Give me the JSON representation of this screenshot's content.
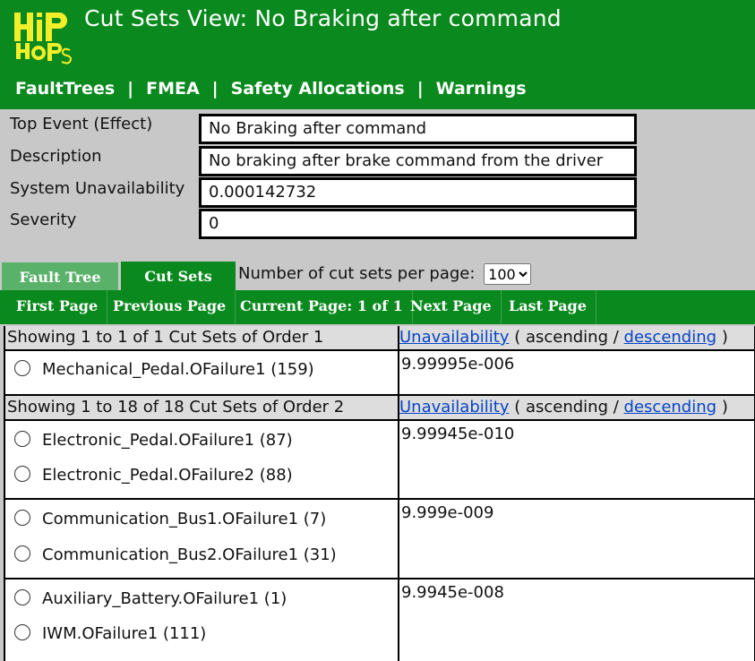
{
  "header": {
    "title": "Cut Sets View: No Braking after command",
    "logo_text": "HiP-HOPS",
    "nav": [
      "FaultTrees",
      "FMEA",
      "Safety Allocations",
      "Warnings"
    ],
    "nav_separator": "|"
  },
  "info": {
    "top_event_label": "Top Event (Effect)",
    "top_event_value": "No Braking after command",
    "description_label": "Description",
    "description_value": "No braking after brake command from the driver",
    "unavailability_label": "System Unavailability",
    "unavailability_value": "0.000142732",
    "severity_label": "Severity",
    "severity_value": "0"
  },
  "tabs": {
    "fault_tree": "Fault Tree",
    "cut_sets": "Cut Sets",
    "active": "Cut Sets"
  },
  "per_page": {
    "label": "Number of cut sets per page:",
    "value": "100"
  },
  "pager": {
    "first": "First Page",
    "previous": "Previous Page",
    "current": "Current Page: 1 of 1",
    "next": "Next Page",
    "last": "Last Page"
  },
  "sort": {
    "unavailability": "Unavailability",
    "open": "(",
    "ascending": "ascending /",
    "descending": "descending",
    "close": ")"
  },
  "groups": [
    {
      "heading": "Showing 1 to 1 of 1 Cut Sets of Order 1",
      "rows": [
        {
          "items": [
            "Mechanical_Pedal.OFailure1 (159)"
          ],
          "value": "9.99995e-006"
        }
      ]
    },
    {
      "heading": "Showing 1 to 18 of 18 Cut Sets of Order 2",
      "rows": [
        {
          "items": [
            "Electronic_Pedal.OFailure1 (87)",
            "Electronic_Pedal.OFailure2 (88)"
          ],
          "value": "9.99945e-010"
        },
        {
          "items": [
            "Communication_Bus1.OFailure1 (7)",
            "Communication_Bus2.OFailure1 (31)"
          ],
          "value": "9.999e-009"
        },
        {
          "items": [
            "Auxiliary_Battery.OFailure1 (1)",
            "IWM.OFailure1 (111)"
          ],
          "value": "9.9945e-008"
        }
      ]
    }
  ],
  "colors": {
    "header_green": "#0a8a1e",
    "inactive_tab": "#5ab26a",
    "logo_yellow": "#f2ee2a",
    "link_blue": "#0645c8"
  }
}
